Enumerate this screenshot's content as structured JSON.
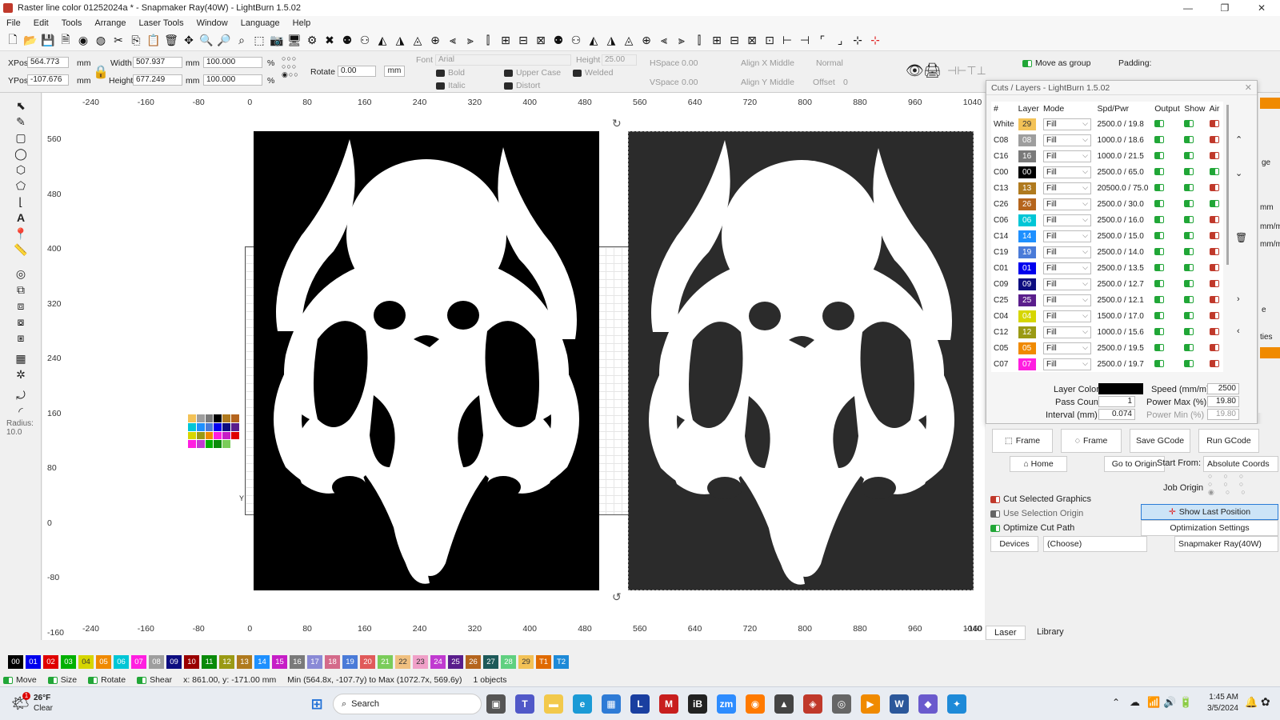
{
  "window": {
    "title": "Raster line color 01252024a * - Snapmaker Ray(40W) - LightBurn 1.5.02",
    "min": "—",
    "max": "❐",
    "close": "✕"
  },
  "menu": [
    "File",
    "Edit",
    "Tools",
    "Arrange",
    "Laser Tools",
    "Window",
    "Language",
    "Help"
  ],
  "props": {
    "xpos_label": "XPos",
    "xpos": "564.773",
    "ypos_label": "YPos",
    "ypos": "-107.676",
    "unit": "mm",
    "width_label": "Width",
    "width": "507.937",
    "height_label": "Height",
    "height": "677.249",
    "scale_w": "100.000",
    "scale_h": "100.000",
    "pct": "%",
    "rotate_label": "Rotate",
    "rotate": "0.00",
    "mm_btn": "mm",
    "font_label": "Font",
    "font": "Arial",
    "fheight_label": "Height",
    "fheight": "25.00",
    "bold": "Bold",
    "italic": "Italic",
    "upper": "Upper Case",
    "distort": "Distort",
    "welded": "Welded",
    "hspace_label": "HSpace",
    "hspace": "0.00",
    "vspace_label": "VSpace",
    "vspace": "0.00",
    "alignx_label": "Align X",
    "alignx": "Middle",
    "aligny_label": "Align Y",
    "aligny": "Middle",
    "normal": "Normal",
    "offset_label": "Offset",
    "offset": "0",
    "move_group": "Move as group",
    "padding": "Padding:"
  },
  "rulers": {
    "x": [
      "-240",
      "-160",
      "-80",
      "0",
      "80",
      "160",
      "240",
      "320",
      "400",
      "480",
      "560",
      "640",
      "720",
      "800",
      "880",
      "960",
      "1040"
    ],
    "y": [
      "560",
      "480",
      "400",
      "320",
      "240",
      "160",
      "80",
      "0",
      "-80",
      "-160"
    ],
    "y_mark": "Y",
    "radius_label": "Radius:",
    "radius": "10.0"
  },
  "cuts": {
    "title": "Cuts / Layers - LightBurn 1.5.02",
    "headers": [
      "#",
      "Layer",
      "Mode",
      "Spd/Pwr",
      "Output",
      "Show",
      "Air"
    ],
    "rows": [
      {
        "id": "White",
        "layer": "29",
        "color": "#f3c257",
        "tc": "#333",
        "mode": "Fill",
        "sp": "2500.0 / 19.8",
        "air": "r"
      },
      {
        "id": "C08",
        "layer": "08",
        "color": "#9e9e9e",
        "tc": "#fff",
        "mode": "Fill",
        "sp": "1000.0 / 18.6",
        "air": "r"
      },
      {
        "id": "C16",
        "layer": "16",
        "color": "#7a7a7a",
        "tc": "#fff",
        "mode": "Fill",
        "sp": "1000.0 / 21.5",
        "air": "r"
      },
      {
        "id": "C00",
        "layer": "00",
        "color": "#000000",
        "tc": "#fff",
        "mode": "Fill",
        "sp": "2500.0 / 65.0",
        "air": "g"
      },
      {
        "id": "C13",
        "layer": "13",
        "color": "#b07a1e",
        "tc": "#fff",
        "mode": "Fill",
        "sp": "20500.0 / 75.0",
        "air": "r"
      },
      {
        "id": "C26",
        "layer": "26",
        "color": "#b5651d",
        "tc": "#fff",
        "mode": "Fill",
        "sp": "2500.0 / 30.0",
        "air": "g"
      },
      {
        "id": "C06",
        "layer": "06",
        "color": "#00c6d6",
        "tc": "#fff",
        "mode": "Fill",
        "sp": "2500.0 / 16.0",
        "air": "r"
      },
      {
        "id": "C14",
        "layer": "14",
        "color": "#1e90ff",
        "tc": "#fff",
        "mode": "Fill",
        "sp": "2500.0 / 15.0",
        "air": "r"
      },
      {
        "id": "C19",
        "layer": "19",
        "color": "#4a7bd8",
        "tc": "#fff",
        "mode": "Fill",
        "sp": "2500.0 / 14.0",
        "air": "r"
      },
      {
        "id": "C01",
        "layer": "01",
        "color": "#0000ee",
        "tc": "#fff",
        "mode": "Fill",
        "sp": "2500.0 / 13.5",
        "air": "r"
      },
      {
        "id": "C09",
        "layer": "09",
        "color": "#0d0d80",
        "tc": "#fff",
        "mode": "Fill",
        "sp": "2500.0 / 12.7",
        "air": "r"
      },
      {
        "id": "C25",
        "layer": "25",
        "color": "#5a1e8c",
        "tc": "#fff",
        "mode": "Fill",
        "sp": "2500.0 / 12.1",
        "air": "r"
      },
      {
        "id": "C04",
        "layer": "04",
        "color": "#d6d600",
        "tc": "#fff",
        "mode": "Fill",
        "sp": "1500.0 / 17.0",
        "air": "r"
      },
      {
        "id": "C12",
        "layer": "12",
        "color": "#9a9a14",
        "tc": "#fff",
        "mode": "Fill",
        "sp": "1000.0 / 15.6",
        "air": "r"
      },
      {
        "id": "C05",
        "layer": "05",
        "color": "#f08a00",
        "tc": "#fff",
        "mode": "Fill",
        "sp": "2500.0 / 19.5",
        "air": "r"
      },
      {
        "id": "C07",
        "layer": "07",
        "color": "#ff1ee0",
        "tc": "#fff",
        "mode": "Fill",
        "sp": "2500.0 / 19.7",
        "air": "r"
      }
    ],
    "layer_color_label": "Layer Color",
    "speed_label": "Speed (mm/m)",
    "speed": "2500",
    "pass_label": "Pass Count",
    "pass": "1",
    "pmax_label": "Power Max (%)",
    "pmax": "19.80",
    "interval_label": "Interval (mm)",
    "interval": "0.074",
    "pmin_label": "Power Min (%)",
    "pmin": "19.80"
  },
  "side": {
    "ge": "ge",
    "mm": "mm",
    "mmm1": "mm/m",
    "mmm2": "mm/m",
    "e": "e",
    "ties": "ties"
  },
  "laser": {
    "frame1": "Frame",
    "frame2": "Frame",
    "save_gcode": "Save GCode",
    "run_gcode": "Run GCode",
    "home": "Home",
    "go_origin": "Go to Origin",
    "start_from_label": "Start From:",
    "start_from": "Absolute Coords",
    "job_origin": "Job Origin",
    "cut_selected": "Cut Selected Graphics",
    "use_sel_origin": "Use Selection Origin",
    "optimize": "Optimize Cut Path",
    "show_last": "Show Last Position",
    "opt_settings": "Optimization Settings",
    "devices": "Devices",
    "choose": "(Choose)",
    "device": "Snapmaker Ray(40W)",
    "tab_laser": "Laser",
    "tab_library": "Library"
  },
  "palette": [
    {
      "l": "00",
      "c": "#000000"
    },
    {
      "l": "01",
      "c": "#0000ee"
    },
    {
      "l": "02",
      "c": "#e00000"
    },
    {
      "l": "03",
      "c": "#00b000"
    },
    {
      "l": "04",
      "c": "#d6d600"
    },
    {
      "l": "05",
      "c": "#f08a00"
    },
    {
      "l": "06",
      "c": "#00c6d6"
    },
    {
      "l": "07",
      "c": "#ff1ee0"
    },
    {
      "l": "08",
      "c": "#9e9e9e"
    },
    {
      "l": "09",
      "c": "#0d0d80"
    },
    {
      "l": "10",
      "c": "#9a0000"
    },
    {
      "l": "11",
      "c": "#0a8a0a"
    },
    {
      "l": "12",
      "c": "#9a9a14"
    },
    {
      "l": "13",
      "c": "#b07a1e"
    },
    {
      "l": "14",
      "c": "#1e90ff"
    },
    {
      "l": "15",
      "c": "#c61ec6"
    },
    {
      "l": "16",
      "c": "#7a7a7a"
    },
    {
      "l": "17",
      "c": "#8a8ad6"
    },
    {
      "l": "18",
      "c": "#d46a8a"
    },
    {
      "l": "19",
      "c": "#4a7bd8"
    },
    {
      "l": "20",
      "c": "#e05a5a"
    },
    {
      "l": "21",
      "c": "#7acc5a"
    },
    {
      "l": "22",
      "c": "#f0c080"
    },
    {
      "l": "23",
      "c": "#f0a0c8"
    },
    {
      "l": "24",
      "c": "#c03ad0"
    },
    {
      "l": "25",
      "c": "#5a1e8c"
    },
    {
      "l": "26",
      "c": "#b5651d"
    },
    {
      "l": "27",
      "c": "#1e5a5a"
    },
    {
      "l": "28",
      "c": "#60d080"
    },
    {
      "l": "29",
      "c": "#f3c257"
    },
    {
      "l": "T1",
      "c": "#e06a00"
    },
    {
      "l": "T2",
      "c": "#1e8ad8"
    }
  ],
  "status": {
    "move": "Move",
    "size": "Size",
    "rotate": "Rotate",
    "shear": "Shear",
    "coords": "x: 861.00, y: -171.00 mm",
    "bounds": "Min (564.8x, -107.7y) to Max (1072.7x, 569.6y)",
    "objects": "1 objects"
  },
  "taskbar": {
    "temp": "26°F",
    "weather": "Clear",
    "badge": "1",
    "search": "Search",
    "time": "1:45 AM",
    "date": "3/5/2024"
  }
}
